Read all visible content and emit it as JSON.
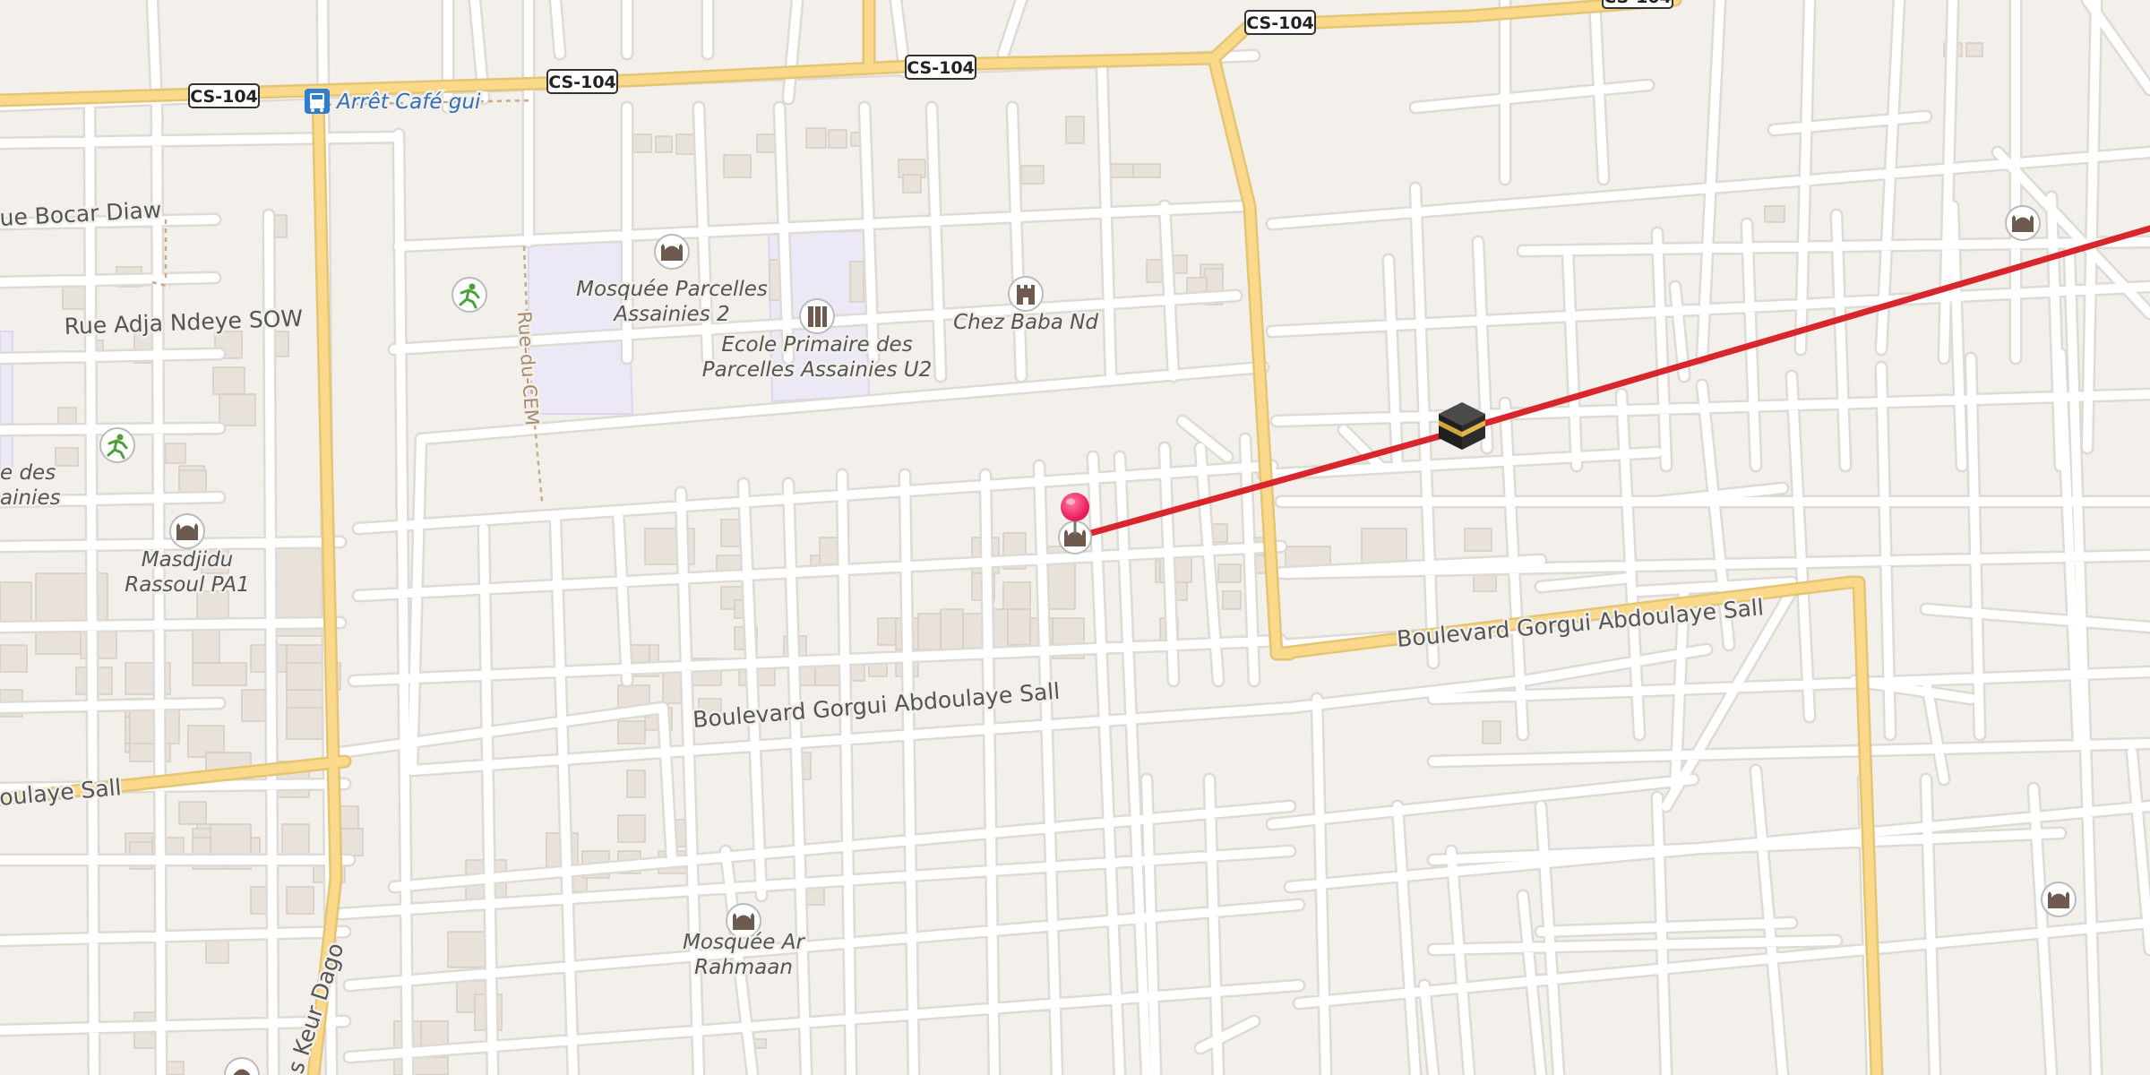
{
  "map": {
    "road_shield": "CS-104",
    "colors": {
      "background": "#f3f0ec",
      "street": "#ffffff",
      "street_casing": "#dedad4",
      "main_road": "#fbd98b",
      "main_road_casing": "#e5c574",
      "building": "#e8e2da",
      "building_outline": "#d5cec4",
      "school_area": "#ece8f6",
      "route_line": "#d9262c",
      "pin": "#e8185a",
      "poi_icon": "#6e5a4e",
      "bus_stop": "#2f7fd0",
      "park_icon": "#4aa13c"
    },
    "places": {
      "bus_stop": "Arrêt Café gui",
      "mosque_parcelles_2": [
        "Mosquée Parcelles",
        "Assainies 2"
      ],
      "school": [
        "Ecole Primaire des",
        "Parcelles Assainies U2"
      ],
      "chez_baba": "Chez Baba Nd",
      "masdjidu": [
        "Masdjidu",
        "Rassoul PA1"
      ],
      "mosque_ar_rahmaan": [
        "Mosquée Ar",
        "Rahmaan"
      ],
      "partial_left": [
        "e des",
        "ainies"
      ]
    },
    "streets": {
      "bocar_diaw": "ue Bocar Diaw",
      "adja_ndeye": "Rue Adja Ndeye SOW",
      "rue_cem": "Rue-du-CEM",
      "boulevard_center": "Boulevard Gorgui Abdoulaye Sall",
      "boulevard_right": "Boulevard Gorgui Abdoulaye Sall",
      "boulevard_left_partial": "oulaye Sall",
      "keur_dago_partial": "s Keur Dago"
    },
    "icons": [
      "mosque-icon",
      "school-icon",
      "tower-icon",
      "bus-stop-icon",
      "sports-icon",
      "kaaba-icon",
      "location-pin-icon"
    ]
  }
}
